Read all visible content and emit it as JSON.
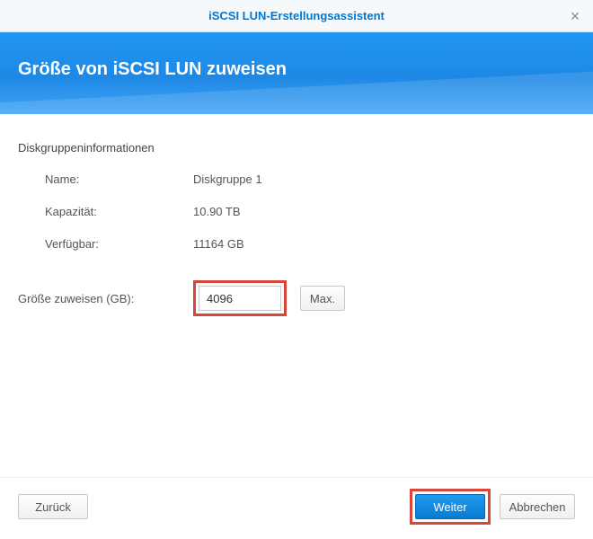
{
  "window": {
    "title": "iSCSI LUN-Erstellungsassistent"
  },
  "hero": {
    "heading": "Größe von iSCSI LUN zuweisen"
  },
  "diskgroup": {
    "section_label": "Diskgruppeninformationen",
    "name_label": "Name:",
    "name_value": "Diskgruppe 1",
    "capacity_label": "Kapazität:",
    "capacity_value": "10.90 TB",
    "available_label": "Verfügbar:",
    "available_value": "11164 GB"
  },
  "size": {
    "label": "Größe zuweisen (GB):",
    "value": "4096",
    "max_label": "Max."
  },
  "footer": {
    "back": "Zurück",
    "next": "Weiter",
    "cancel": "Abbrechen"
  }
}
